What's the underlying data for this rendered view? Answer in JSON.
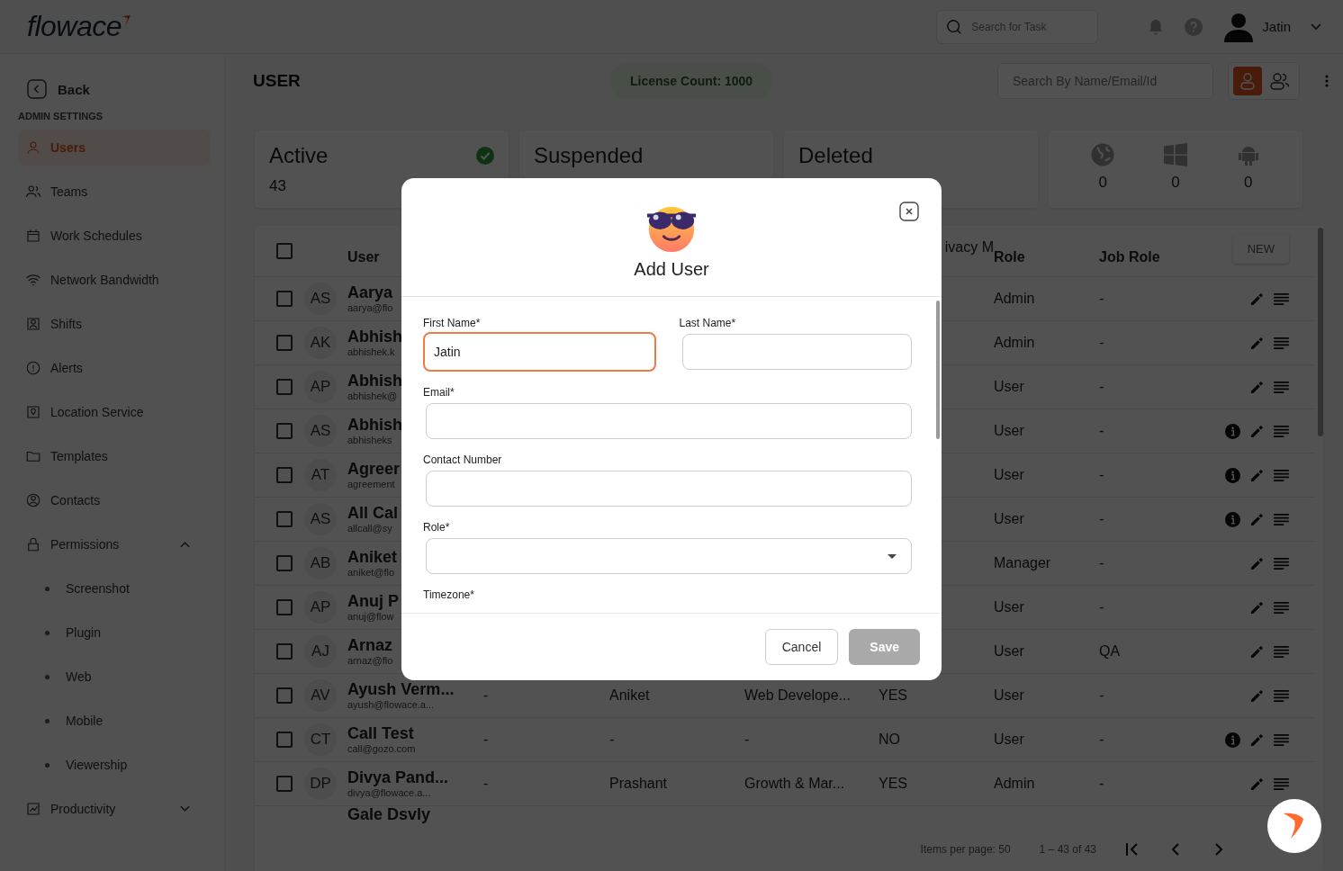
{
  "top_bar": {
    "logo": "flowace",
    "search": {
      "placeholder": "Search for Task"
    },
    "user_name": "Jatin"
  },
  "sidebar": {
    "back": "Back",
    "section": "ADMIN SETTINGS",
    "items": [
      {
        "label": "Users",
        "selected": true
      },
      {
        "label": "Teams",
        "selected": false
      },
      {
        "label": "Work Schedules",
        "selected": false
      },
      {
        "label": "Network Bandwidth",
        "selected": false
      },
      {
        "label": "Shifts",
        "selected": false
      },
      {
        "label": "Alerts",
        "selected": false
      },
      {
        "label": "Location Service",
        "selected": false
      },
      {
        "label": "Templates",
        "selected": false
      },
      {
        "label": "Contacts",
        "selected": false
      },
      {
        "label": "Permissions",
        "selected": false,
        "expanded": true,
        "children": [
          {
            "label": "Screenshot",
            "selected": false
          },
          {
            "label": "Plugin",
            "selected": false
          },
          {
            "label": "Web",
            "selected": false
          },
          {
            "label": "Mobile",
            "selected": false
          },
          {
            "label": "Viewership",
            "selected": false
          }
        ]
      },
      {
        "label": "Productivity",
        "selected": false,
        "expanded": false
      }
    ]
  },
  "header": {
    "title": "USER",
    "license": "License Count: 1000",
    "search": {
      "placeholder": "Search By Name/Email/Id"
    },
    "view_toggle": [
      {
        "kind": "single",
        "selected": true
      },
      {
        "kind": "group",
        "selected": false
      }
    ]
  },
  "status_cards": [
    {
      "kind": "active",
      "label": "Active",
      "count": "43"
    },
    {
      "kind": "plain",
      "label": "Suspended"
    },
    {
      "kind": "plain",
      "label": "Deleted"
    }
  ],
  "platform_counts": [
    {
      "kind": "web",
      "count": "0"
    },
    {
      "kind": "windows",
      "count": "0"
    },
    {
      "kind": "android",
      "count": "0"
    }
  ],
  "table": {
    "columns": {
      "user": "User",
      "column_6": "ivacy M",
      "role": "Role",
      "job_role": "Job Role"
    },
    "new_button": "NEW",
    "header_checked": false,
    "rows": [
      {
        "checked": false,
        "initials": "AS",
        "name": "Aarya",
        "email": "aarya@flo",
        "role": "Admin",
        "job_role": "-",
        "info": false
      },
      {
        "checked": false,
        "initials": "AK",
        "name": "Abhish",
        "email": "abhishek.k",
        "role": "Admin",
        "job_role": "-",
        "info": false
      },
      {
        "checked": false,
        "initials": "AP",
        "name": "Abhish",
        "email": "abhishek@",
        "role": "User",
        "job_role": "-",
        "info": false
      },
      {
        "checked": false,
        "initials": "AS",
        "name": "Abhish",
        "email": "abhisheks",
        "role": "User",
        "job_role": "-",
        "info": true
      },
      {
        "checked": false,
        "initials": "AT",
        "name": "Agreer",
        "email": "agreement",
        "role": "User",
        "job_role": "-",
        "info": true
      },
      {
        "checked": false,
        "initials": "AS",
        "name": "All Cal",
        "email": "allcall@sy",
        "role": "User",
        "job_role": "-",
        "info": true
      },
      {
        "checked": false,
        "initials": "AB",
        "name": "Aniket",
        "email": "aniket@flo",
        "role": "Manager",
        "job_role": "-",
        "info": false
      },
      {
        "checked": false,
        "initials": "AP",
        "name": "Anuj P",
        "email": "anuj@flow",
        "role": "User",
        "job_role": "-",
        "info": false
      },
      {
        "checked": false,
        "initials": "AJ",
        "name": "Arnaz",
        "email": "arnaz@flo",
        "role": "User",
        "job_role": "QA",
        "info": false
      },
      {
        "checked": false,
        "initials": "AV",
        "name": "Ayush Verm...",
        "email": "ayush@flowace.a...",
        "column_3": "-",
        "column_4": "Aniket",
        "column_5": "Web Develope...",
        "column_6": "YES",
        "role": "User",
        "job_role": "-",
        "info": false
      },
      {
        "checked": false,
        "initials": "CT",
        "name": "Call Test",
        "email": "call@gozo.com",
        "column_3": "-",
        "column_4": "-",
        "column_5": "-",
        "column_6": "NO",
        "role": "User",
        "job_role": "-",
        "info": true
      },
      {
        "checked": false,
        "initials": "DP",
        "name": "Divya Pand...",
        "email": "divya@flowace.a...",
        "column_3": "-",
        "column_4": "Prashant",
        "column_5": "Growth & Mar...",
        "column_6": "YES",
        "role": "Admin",
        "job_role": "-",
        "info": false
      },
      {
        "name": "Gale Dsvly"
      }
    ]
  },
  "pagination": {
    "items_per_page": "Items per page: 50",
    "range": "1 – 43 of 43"
  },
  "modal": {
    "title": "Add User",
    "rows": [
      [
        {
          "kind": "text",
          "label": "First Name*",
          "value": "Jatin",
          "focused": true
        },
        {
          "kind": "text",
          "label": "Last Name*",
          "focused": false
        }
      ],
      [
        {
          "kind": "text",
          "label": "Email*",
          "focused": false
        }
      ],
      [
        {
          "kind": "text",
          "label": "Contact Number",
          "focused": false
        }
      ],
      [
        {
          "kind": "select",
          "label": "Role*",
          "focused": false
        }
      ],
      [
        {
          "kind": "label",
          "label": "Timezone*"
        }
      ]
    ],
    "buttons": [
      {
        "kind": "secondary",
        "label": "Cancel",
        "disabled": false
      },
      {
        "kind": "primary",
        "label": "Save",
        "disabled": true
      }
    ]
  }
}
